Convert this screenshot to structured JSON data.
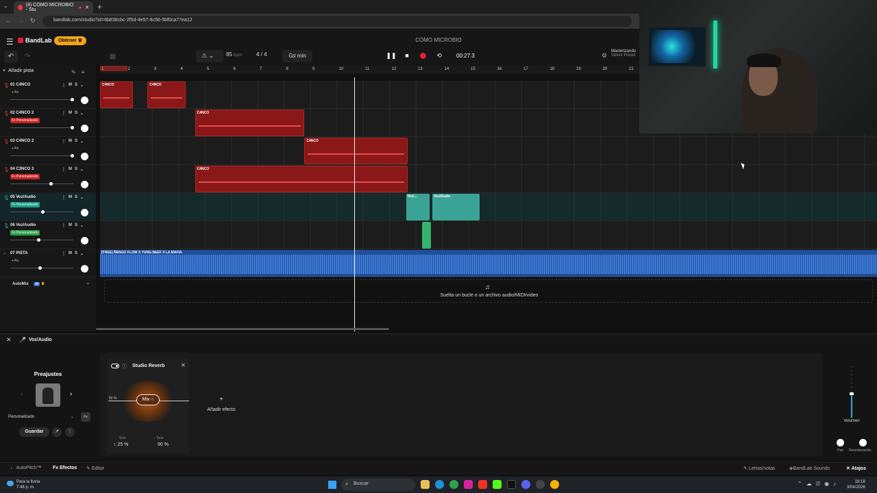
{
  "browser": {
    "tab_title": "(4) COMO MICROBIO - Stu",
    "url": "bandlab.com/studio?id=6b838cbc-2f5d-4e57-8c56-5bf0ca77ea12"
  },
  "header": {
    "brand": "BandLab",
    "get_button": "Obtener",
    "project_title": "COMO MICROBIO",
    "bpm": "85",
    "bpm_unit": "bpm",
    "time_signature": "4 / 4",
    "key": "G♯ min",
    "time": "00:27.3",
    "mastering_label": "Masterizando",
    "mastering_sub": "Select Preset"
  },
  "track_panel": {
    "add_track": "Añadir pista",
    "automix": "AutoMix",
    "automix_badge": "AI"
  },
  "tracks": [
    {
      "number_name": "01  C4NCO",
      "fx": "+ Fx",
      "fx_style": "plain",
      "kind": "mic",
      "mute": "M",
      "solo": "S",
      "volume": 0.98
    },
    {
      "number_name": "02  C4NCO 2",
      "fx": "Fx Personalizado",
      "fx_style": "red",
      "kind": "mic",
      "mute": "M",
      "solo": "S",
      "volume": 0.98
    },
    {
      "number_name": "03  C4NCO 2",
      "fx": "+ Fx",
      "fx_style": "plain",
      "kind": "mic",
      "mute": "M",
      "solo": "S",
      "volume": 0.98
    },
    {
      "number_name": "04  C3NCO 3",
      "fx": "Fx Personalizado",
      "fx_style": "red",
      "kind": "mic",
      "mute": "M",
      "solo": "S",
      "volume": 0.63
    },
    {
      "number_name": "05  Voz/Audio",
      "fx": "Fx Personalizado",
      "fx_style": "teal",
      "kind": "voice",
      "mute": "M",
      "solo": "S",
      "volume": 0.5
    },
    {
      "number_name": "06  Voz/Audio",
      "fx": "Fx Personalizado",
      "fx_style": "green",
      "kind": "voice",
      "mute": "M",
      "solo": "S",
      "volume": 0.43
    },
    {
      "number_name": "07  PISTA",
      "fx": "+ Fx",
      "fx_style": "plain",
      "kind": "audio",
      "mute": "M",
      "solo": "S",
      "volume": 0.46
    }
  ],
  "ruler": [
    "1",
    "2",
    "3",
    "4",
    "5",
    "6",
    "7",
    "8",
    "9",
    "10",
    "11",
    "12",
    "13",
    "14",
    "15",
    "16",
    "17",
    "18",
    "19",
    "20",
    "21"
  ],
  "clips": [
    {
      "lane": 0,
      "name": "C4NCO",
      "color": "red",
      "bar_start": 1,
      "bar_len": 1.25
    },
    {
      "lane": 0,
      "name": "C4NCO",
      "color": "red",
      "bar_start": 2.8,
      "bar_len": 1.45
    },
    {
      "lane": 1,
      "name": "C4NCO",
      "color": "red",
      "bar_start": 4.6,
      "bar_len": 4.15
    },
    {
      "lane": 2,
      "name": "C4NCO",
      "color": "red",
      "bar_start": 8.75,
      "bar_len": 3.9
    },
    {
      "lane": 3,
      "name": "C4NCO",
      "color": "red",
      "bar_start": 4.6,
      "bar_len": 8.05
    },
    {
      "lane": 4,
      "name": "Voz/...",
      "color": "teal",
      "bar_start": 12.6,
      "bar_len": 0.9
    },
    {
      "lane": 4,
      "name": "Voz/Audio",
      "color": "teal",
      "bar_start": 13.6,
      "bar_len": 1.8
    },
    {
      "lane": 5,
      "name": "",
      "color": "green",
      "bar_start": 13.2,
      "bar_len": 0.35
    },
    {
      "lane": 6,
      "name": "[FREE] ÑENGO FLOW X YUNG BEEF X LA MAFIA",
      "color": "blue",
      "bar_start": 1,
      "bar_len": 30
    }
  ],
  "drop_zone": "Suelta un bucle o un archivo audio/MIDI/video",
  "bottom": {
    "selected_track": "Voz/Audio",
    "presets_title": "Preajustes",
    "preset_dropdown": "Personalizado",
    "fx_btn": "Fx",
    "save": "Guardar",
    "effect_name": "Studio Reverb",
    "mix_label": "Mix",
    "mix_percent": "50 %",
    "size_label": "Size",
    "size_value": "25 %",
    "tone_label": "Tone",
    "tone_value": "90 %",
    "add_effect": "Añadir efecto",
    "volume_label": "Volumen",
    "volume_level": 0.47,
    "pan_label": "Pan",
    "reverb_label": "Reverberación"
  },
  "footer": {
    "autopitch": "AutoPitch™",
    "efectos": "Efectos",
    "editor": "Editor",
    "lyrics": "Letras/notas",
    "sounds": "BandLab Sounds",
    "shortcuts": "Atajos"
  },
  "taskbar": {
    "weather": "Para la lluvia",
    "weather_time": "7:48 p. m.",
    "search": "Buscar",
    "time": "19:18",
    "date": "3/04/2026"
  },
  "colors": {
    "accent_red": "#e3212e",
    "clip_red": "#8a1818",
    "clip_teal": "#3aa396",
    "clip_blue": "#1f4e9a",
    "obtener": "#f3a31a"
  }
}
